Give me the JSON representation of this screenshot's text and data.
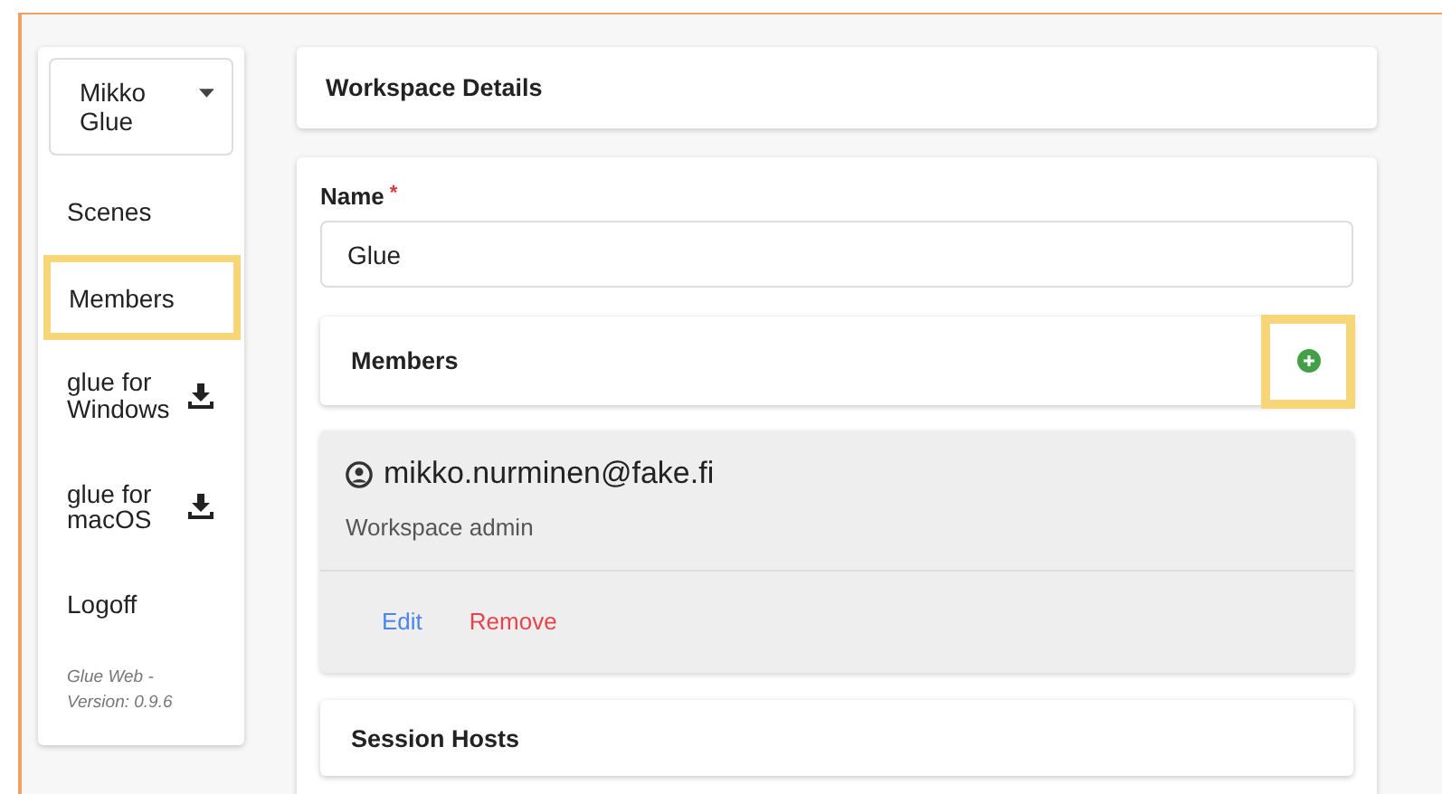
{
  "user_menu": {
    "label": "Mikko Glue"
  },
  "nav": [
    {
      "kind": "link",
      "label": "Scenes",
      "highlighted": false
    },
    {
      "kind": "link",
      "label": "Members",
      "highlighted": true
    },
    {
      "kind": "download",
      "label": "glue for Windows",
      "highlighted": false
    },
    {
      "kind": "download",
      "label": "glue for macOS",
      "highlighted": false
    },
    {
      "kind": "link",
      "label": "Logoff",
      "highlighted": false
    }
  ],
  "version": "Glue Web - Version: 0.9.6",
  "header": {
    "title": "Workspace Details"
  },
  "form": {
    "name_label": "Name",
    "required_mark": "*",
    "name_value": "Glue",
    "members": {
      "title": "Members",
      "add_highlighted": true,
      "items": [
        {
          "email": "mikko.nurminen@fake.fi",
          "role": "Workspace admin",
          "edit": "Edit",
          "remove": "Remove"
        }
      ]
    },
    "session_hosts": {
      "title": "Session Hosts"
    }
  }
}
